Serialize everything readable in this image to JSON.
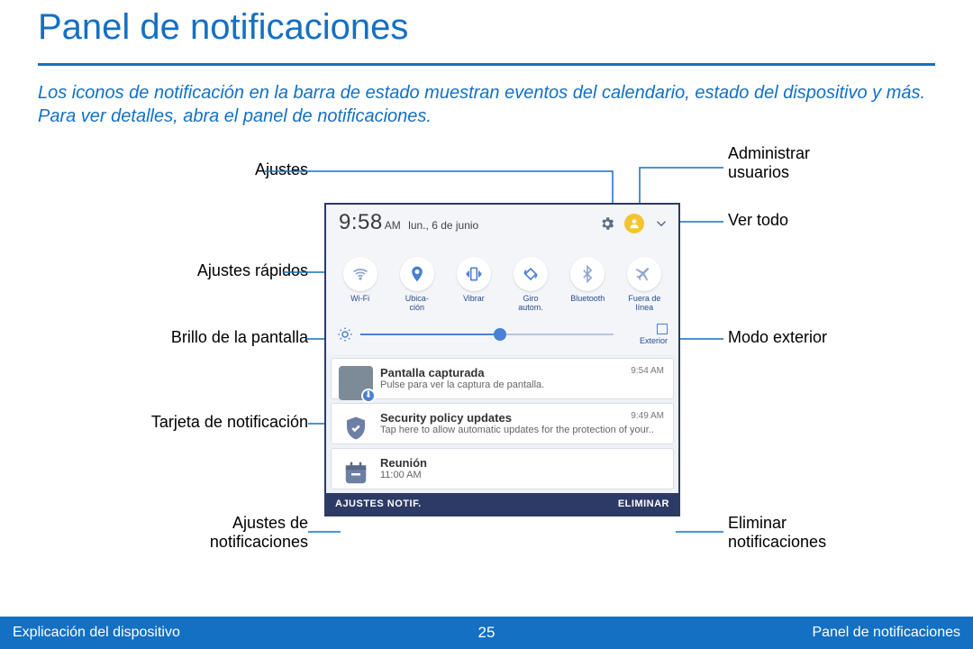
{
  "title": "Panel de notificaciones",
  "intro": "Los iconos de notificación en la barra de estado muestran eventos del calendario, estado del dispositivo y más. Para ver detalles, abra el panel de notificaciones.",
  "callouts": {
    "left": {
      "ajustes": "Ajustes",
      "ajustes_rapidos": "Ajustes rápidos",
      "brillo": "Brillo de la pantalla",
      "tarjeta": "Tarjeta de notificación",
      "ajustes_notif": "Ajustes de\nnotificaciones"
    },
    "right": {
      "admin_usuarios": "Administrar\nusuarios",
      "ver_todo": "Ver todo",
      "modo_ext": "Modo exterior",
      "eliminar": "Eliminar\nnotificaciones"
    }
  },
  "panel": {
    "time": "9:58",
    "ampm": "AM",
    "date": "lun., 6 de junio",
    "quick": [
      {
        "key": "wifi",
        "label": "Wi-Fi"
      },
      {
        "key": "ubicacion",
        "label": "Ubica-\nción"
      },
      {
        "key": "vibrar",
        "label": "Vibrar"
      },
      {
        "key": "giro",
        "label": "Giro\nautom."
      },
      {
        "key": "bluetooth",
        "label": "Bluetooth"
      },
      {
        "key": "fuera",
        "label": "Fuera de\nlínea"
      }
    ],
    "exterior_label": "Exterior",
    "notifs": [
      {
        "icon": "thumb",
        "title": "Pantalla capturada",
        "body": "Pulse para ver la captura de pantalla.",
        "time": "9:54 AM"
      },
      {
        "icon": "shield",
        "title": "Security policy updates",
        "body": "Tap here to allow automatic updates for the protection of your..",
        "time": "9:49 AM"
      },
      {
        "icon": "cal",
        "title": "Reunión",
        "body": "11:00 AM",
        "time": ""
      }
    ],
    "footer": {
      "left": "AJUSTES NOTIF.",
      "right": "ELIMINAR"
    }
  },
  "footer": {
    "left": "Explicación del dispositivo",
    "center": "25",
    "right": "Panel de notificaciones"
  }
}
